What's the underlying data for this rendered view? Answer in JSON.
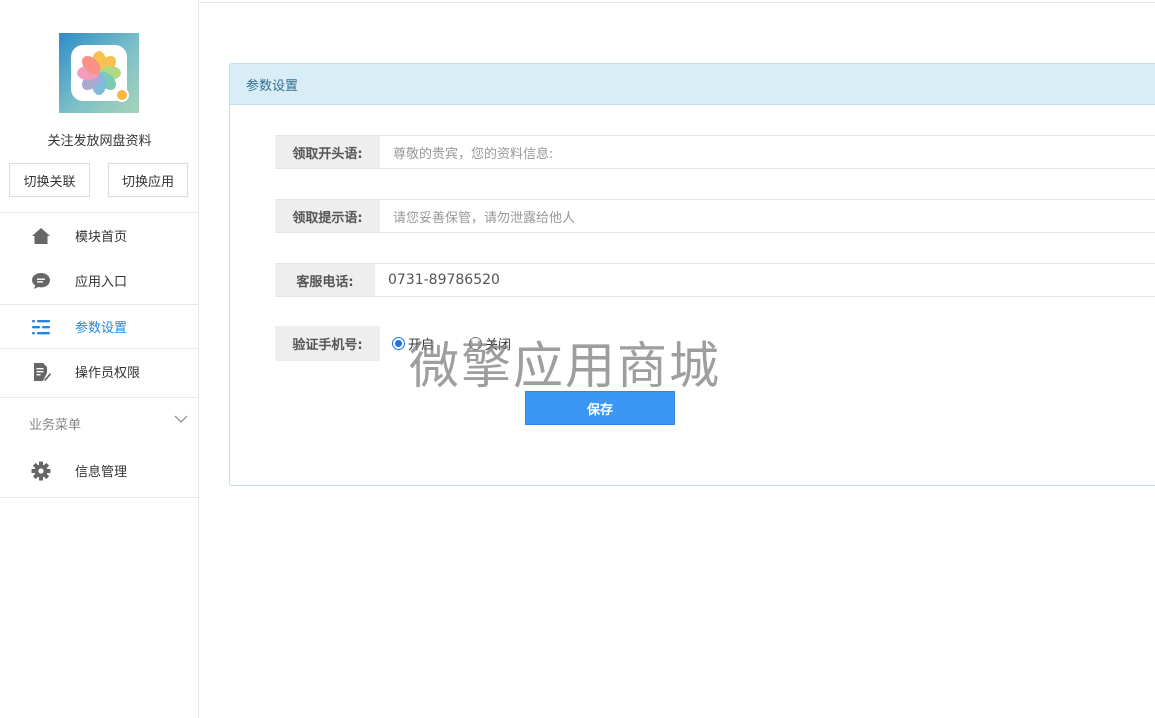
{
  "sidebar": {
    "app_name": "关注发放网盘资料",
    "buttons": [
      "切换关联",
      "切换应用"
    ],
    "items": [
      {
        "label": "模块首页",
        "icon": "home-icon"
      },
      {
        "label": "应用入口",
        "icon": "chat-bubble-icon"
      },
      {
        "label": "参数设置",
        "icon": "sliders-icon",
        "active": true
      },
      {
        "label": "操作员权限",
        "icon": "document-edit-icon"
      }
    ],
    "section_title": "业务菜单",
    "section_items": [
      {
        "label": "信息管理",
        "icon": "gear-icon"
      }
    ]
  },
  "panel": {
    "title": "参数设置",
    "fields": [
      {
        "label": "领取开头语:",
        "value": "尊敬的贵宾，您的资料信息:"
      },
      {
        "label": "领取提示语:",
        "value": "请您妥善保管，请勿泄露给他人"
      },
      {
        "label": "客服电话:",
        "value": "0731-89786520"
      }
    ],
    "verify": {
      "label": "验证手机号:",
      "options": [
        "开启",
        "关闭"
      ],
      "selected": "开启"
    },
    "save_label": "保存"
  },
  "watermark": "微擎应用商城",
  "colors": {
    "accent": "#1e88e5",
    "panel_header_bg": "#d9edf6",
    "save_button": "#3a97f3"
  }
}
